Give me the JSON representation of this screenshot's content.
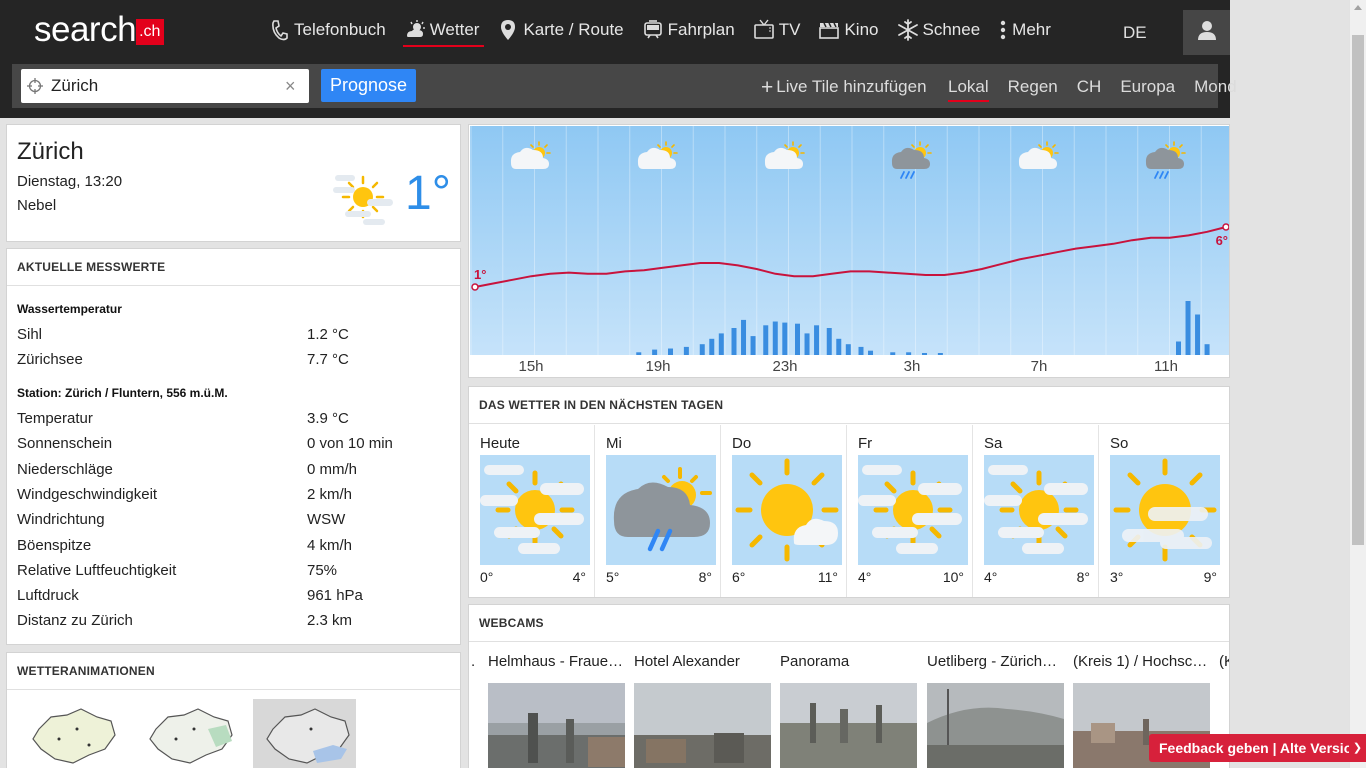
{
  "header": {
    "logo_main": "search",
    "logo_suffix": ".ch",
    "nav": [
      {
        "label": "Telefonbuch",
        "icon": "phone-icon"
      },
      {
        "label": "Wetter",
        "icon": "weather-icon",
        "active": true
      },
      {
        "label": "Karte / Route",
        "icon": "map-pin-icon"
      },
      {
        "label": "Fahrplan",
        "icon": "train-icon"
      },
      {
        "label": "TV",
        "icon": "tv-icon"
      },
      {
        "label": "Kino",
        "icon": "clapperboard-icon"
      },
      {
        "label": "Schnee",
        "icon": "snowflake-icon"
      },
      {
        "label": "Mehr",
        "icon": "more-dots-icon"
      }
    ],
    "language": "DE"
  },
  "search": {
    "value": "Zürich",
    "clear": "×",
    "button": "Prognose"
  },
  "subnav": {
    "live_tile": "Live Tile hinzufügen",
    "items": [
      "Lokal",
      "Regen",
      "CH",
      "Europa",
      "Mond"
    ],
    "active": "Lokal"
  },
  "current": {
    "city": "Zürich",
    "datetime": "Dienstag, 13:20",
    "condition": "Nebel",
    "temperature": "1°",
    "icon": "sun-fog-icon"
  },
  "measurements": {
    "title": "AKTUELLE MESSWERTE",
    "water_title": "Wassertemperatur",
    "water": [
      {
        "label": "Sihl",
        "value": "1.2 °C"
      },
      {
        "label": "Zürichsee",
        "value": "7.7 °C"
      }
    ],
    "station_title": "Station: Zürich / Fluntern, 556 m.ü.M.",
    "station": [
      {
        "label": "Temperatur",
        "value": "3.9 °C"
      },
      {
        "label": "Sonnenschein",
        "value": "0 von 10 min"
      },
      {
        "label": "Niederschläge",
        "value": "0 mm/h"
      },
      {
        "label": "Windgeschwindigkeit",
        "value": "2 km/h"
      },
      {
        "label": "Windrichtung",
        "value": "WSW"
      },
      {
        "label": "Böenspitze",
        "value": "4 km/h"
      },
      {
        "label": "Relative Luftfeuchtigkeit",
        "value": "75%"
      },
      {
        "label": "Luftdruck",
        "value": "961 hPa"
      },
      {
        "label": "Distanz zu Zürich",
        "value": "2.3 km"
      }
    ]
  },
  "animations": {
    "title": "WETTERANIMATIONEN"
  },
  "chart_data": {
    "type": "line",
    "x_tick_labels": [
      "15h",
      "19h",
      "23h",
      "3h",
      "7h",
      "11h"
    ],
    "temperature_start_label": "1°",
    "temperature_end_label": "6°",
    "temperature_series": [
      1.0,
      1.3,
      1.6,
      1.9,
      2.1,
      2.2,
      2.1,
      2.1,
      2.3,
      2.4,
      2.6,
      2.8,
      3.0,
      3.0,
      2.8,
      2.5,
      2.1,
      1.9,
      1.9,
      2.1,
      2.3,
      2.3,
      2.2,
      2.1,
      2.0,
      2.0,
      2.2,
      2.5,
      2.9,
      3.3,
      3.6,
      3.9,
      4.2,
      4.4,
      4.6,
      4.9,
      5.1,
      5.1,
      5.3,
      5.6,
      6.0
    ],
    "precipitation_hours": [
      {
        "h": 3.0,
        "v": 0.05
      },
      {
        "h": 3.5,
        "v": 0.1
      },
      {
        "h": 4.0,
        "v": 0.12
      },
      {
        "h": 4.5,
        "v": 0.15
      },
      {
        "h": 5.0,
        "v": 0.2
      },
      {
        "h": 5.3,
        "v": 0.3
      },
      {
        "h": 5.6,
        "v": 0.4
      },
      {
        "h": 6.0,
        "v": 0.5
      },
      {
        "h": 6.3,
        "v": 0.65
      },
      {
        "h": 6.6,
        "v": 0.35
      },
      {
        "h": 7.0,
        "v": 0.55
      },
      {
        "h": 7.3,
        "v": 0.62
      },
      {
        "h": 7.6,
        "v": 0.6
      },
      {
        "h": 8.0,
        "v": 0.58
      },
      {
        "h": 8.3,
        "v": 0.4
      },
      {
        "h": 8.6,
        "v": 0.55
      },
      {
        "h": 9.0,
        "v": 0.5
      },
      {
        "h": 9.3,
        "v": 0.3
      },
      {
        "h": 9.6,
        "v": 0.2
      },
      {
        "h": 10.0,
        "v": 0.15
      },
      {
        "h": 10.3,
        "v": 0.08
      },
      {
        "h": 11.0,
        "v": 0.05
      },
      {
        "h": 11.5,
        "v": 0.05
      },
      {
        "h": 12.0,
        "v": 0.03
      },
      {
        "h": 12.5,
        "v": 0.03
      },
      {
        "h": 20.0,
        "v": 0.25
      },
      {
        "h": 20.3,
        "v": 1.0
      },
      {
        "h": 20.6,
        "v": 0.75
      },
      {
        "h": 20.9,
        "v": 0.2
      }
    ],
    "hour_icons": [
      "partly-sunny-icon",
      "partly-sunny-icon",
      "partly-sunny-icon",
      "rain-sun-icon",
      "partly-sunny-icon",
      "rain-sun-icon"
    ]
  },
  "forecast": {
    "title": "DAS WETTER IN DEN NÄCHSTEN TAGEN",
    "days": [
      {
        "name": "Heute",
        "min": "0°",
        "max": "4°",
        "icon": "sun-fog-icon"
      },
      {
        "name": "Mi",
        "min": "5°",
        "max": "8°",
        "icon": "rain-cloud-sun-icon"
      },
      {
        "name": "Do",
        "min": "6°",
        "max": "11°",
        "icon": "sun-cloud-icon"
      },
      {
        "name": "Fr",
        "min": "4°",
        "max": "10°",
        "icon": "sun-fog-icon"
      },
      {
        "name": "Sa",
        "min": "4°",
        "max": "8°",
        "icon": "sun-fog-icon"
      },
      {
        "name": "So",
        "min": "3°",
        "max": "9°",
        "icon": "sun-fog-icon"
      }
    ]
  },
  "webcams": {
    "title": "WEBCAMS",
    "prev_partial": ".",
    "items": [
      "Helmhaus - Fraue…",
      "Hotel Alexander",
      "Panorama",
      "Uetliberg - Zürich…",
      "(Kreis 1) / Hochsc…"
    ],
    "next_partial": "(K"
  },
  "feedback": {
    "label": "Feedback geben | Alte Version",
    "chevron": "❯"
  },
  "colors": {
    "header_bg": "#252525",
    "brand_red": "#e3001b",
    "accent_blue": "#2f86f5",
    "temp_blue": "#2e8ee8",
    "temp_line": "#c8133d",
    "precip_blue": "#3a8de0"
  }
}
